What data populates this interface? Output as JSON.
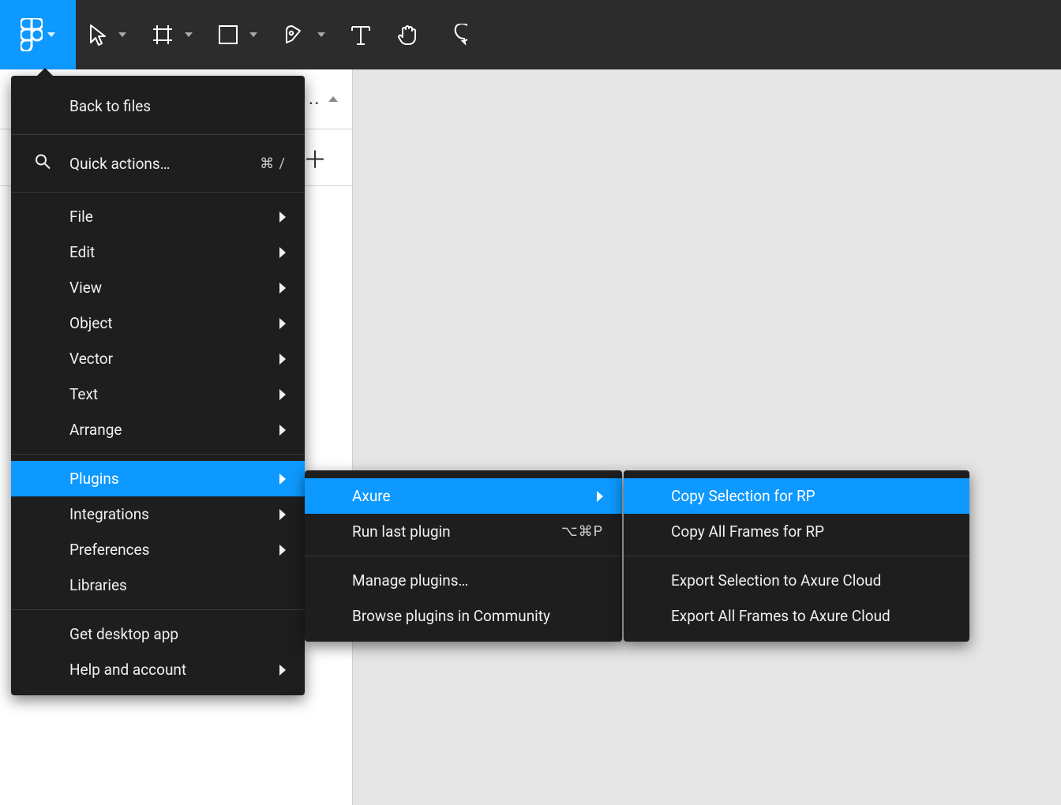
{
  "menu": {
    "back": "Back to files",
    "quick": "Quick actions…",
    "quick_shortcut": "⌘ /",
    "file": "File",
    "edit": "Edit",
    "view": "View",
    "object": "Object",
    "vector": "Vector",
    "text": "Text",
    "arrange": "Arrange",
    "plugins": "Plugins",
    "integrations": "Integrations",
    "preferences": "Preferences",
    "libraries": "Libraries",
    "desktop": "Get desktop app",
    "help": "Help and account"
  },
  "plugins_submenu": {
    "axure": "Axure",
    "runlast": "Run last plugin",
    "runlast_shortcut": "⌥⌘P",
    "manage": "Manage plugins…",
    "browse": "Browse plugins in Community"
  },
  "axure_submenu": {
    "copy_sel": "Copy Selection for RP",
    "copy_all": "Copy All Frames for RP",
    "export_sel": "Export Selection to Axure Cloud",
    "export_all": "Export All Frames to Axure Cloud"
  }
}
